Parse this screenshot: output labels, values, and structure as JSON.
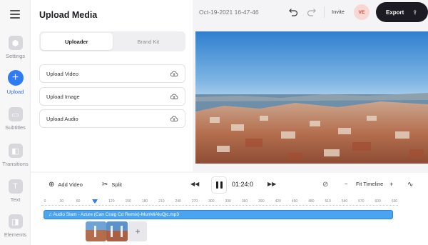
{
  "rail": {
    "items": [
      {
        "label": "Settings"
      },
      {
        "label": "Upload"
      },
      {
        "label": "Subtitles"
      },
      {
        "label": "Transitions"
      },
      {
        "label": "Text"
      },
      {
        "label": "Elements"
      }
    ]
  },
  "panel": {
    "title": "Upload Media",
    "tabs": [
      {
        "label": "Uploader"
      },
      {
        "label": "Brand Kit"
      }
    ],
    "rows": [
      {
        "label": "Upload Video"
      },
      {
        "label": "Upload Image"
      },
      {
        "label": "Upload Audio"
      }
    ]
  },
  "topbar": {
    "doc_title": "Oct-19-2021 16-47-46",
    "invite": "Invite",
    "avatar": "VE",
    "export": "Export"
  },
  "player": {
    "add_video": "Add Video",
    "split": "Split",
    "timecode": "01:24:0",
    "zoom_minus": "−",
    "fit_timeline": "Fit Timeline",
    "zoom_plus": "+"
  },
  "timeline": {
    "ticks": [
      "0",
      "30",
      "60",
      "90",
      "120",
      "150",
      "180",
      "210",
      "240",
      "270",
      "300",
      "330",
      "360",
      "390",
      "420",
      "450",
      "480",
      "510",
      "540",
      "570",
      "600",
      "630"
    ],
    "playhead_value": 90,
    "audio_track": "♫ Audio Slam - Azure (Can Craig Cd Remix)-MunMiAluQjc.mp3",
    "add_clip": "+"
  },
  "colors": {
    "accent": "#2f7bf5",
    "export_bg": "#1c1b24",
    "audio_track": "#4aa4ef"
  }
}
